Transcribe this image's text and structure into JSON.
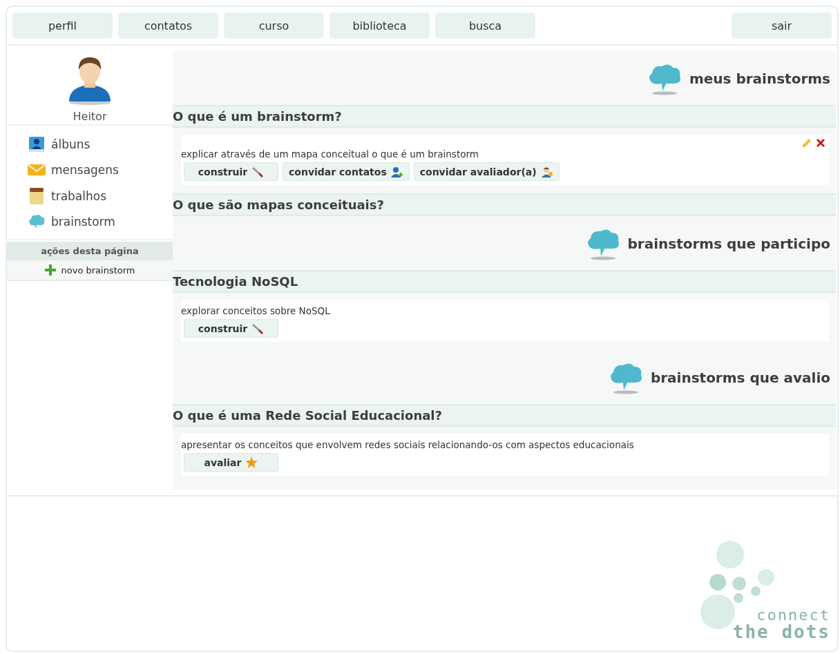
{
  "nav": {
    "tabs": [
      {
        "label": "perfil"
      },
      {
        "label": "contatos"
      },
      {
        "label": "curso"
      },
      {
        "label": "biblioteca"
      },
      {
        "label": "busca"
      }
    ],
    "logout": "sair"
  },
  "sidebar": {
    "user": "Heitor",
    "items": [
      {
        "label": "álbuns",
        "kind": "album"
      },
      {
        "label": "mensagens",
        "kind": "mail"
      },
      {
        "label": "trabalhos",
        "kind": "notebook"
      },
      {
        "label": "brainstorm",
        "kind": "cloud"
      }
    ],
    "actions_title": "ações desta página",
    "actions": [
      {
        "label": "novo brainstorm",
        "kind": "add"
      }
    ]
  },
  "sections": [
    {
      "title": "meus brainstorms",
      "items": [
        {
          "title": "O que é um brainstorm?",
          "editable": true,
          "description": "explicar através de um mapa conceitual o que é um brainstorm",
          "buttons": [
            {
              "label": "construir",
              "kind": "build"
            },
            {
              "label": "convidar contatos",
              "kind": "invite"
            },
            {
              "label": "convidar avaliador(a)",
              "kind": "reviewer"
            }
          ]
        },
        {
          "title": "O que são mapas conceituais?"
        }
      ]
    },
    {
      "title": "brainstorms que participo",
      "items": [
        {
          "title": "Tecnologia NoSQL",
          "editable": false,
          "description": "explorar conceitos sobre NoSQL",
          "buttons": [
            {
              "label": "construir",
              "kind": "build"
            }
          ]
        }
      ]
    },
    {
      "title": "brainstorms que avalio",
      "items": [
        {
          "title": "O que é uma Rede Social Educacional?",
          "editable": false,
          "description": "apresentar os conceitos que envolvem redes sociais relacionando-os com aspectos educacionais",
          "buttons": [
            {
              "label": "avaliar",
              "kind": "star"
            }
          ]
        }
      ]
    }
  ],
  "logo": {
    "line_1": "connect",
    "line_2": "the dots"
  }
}
